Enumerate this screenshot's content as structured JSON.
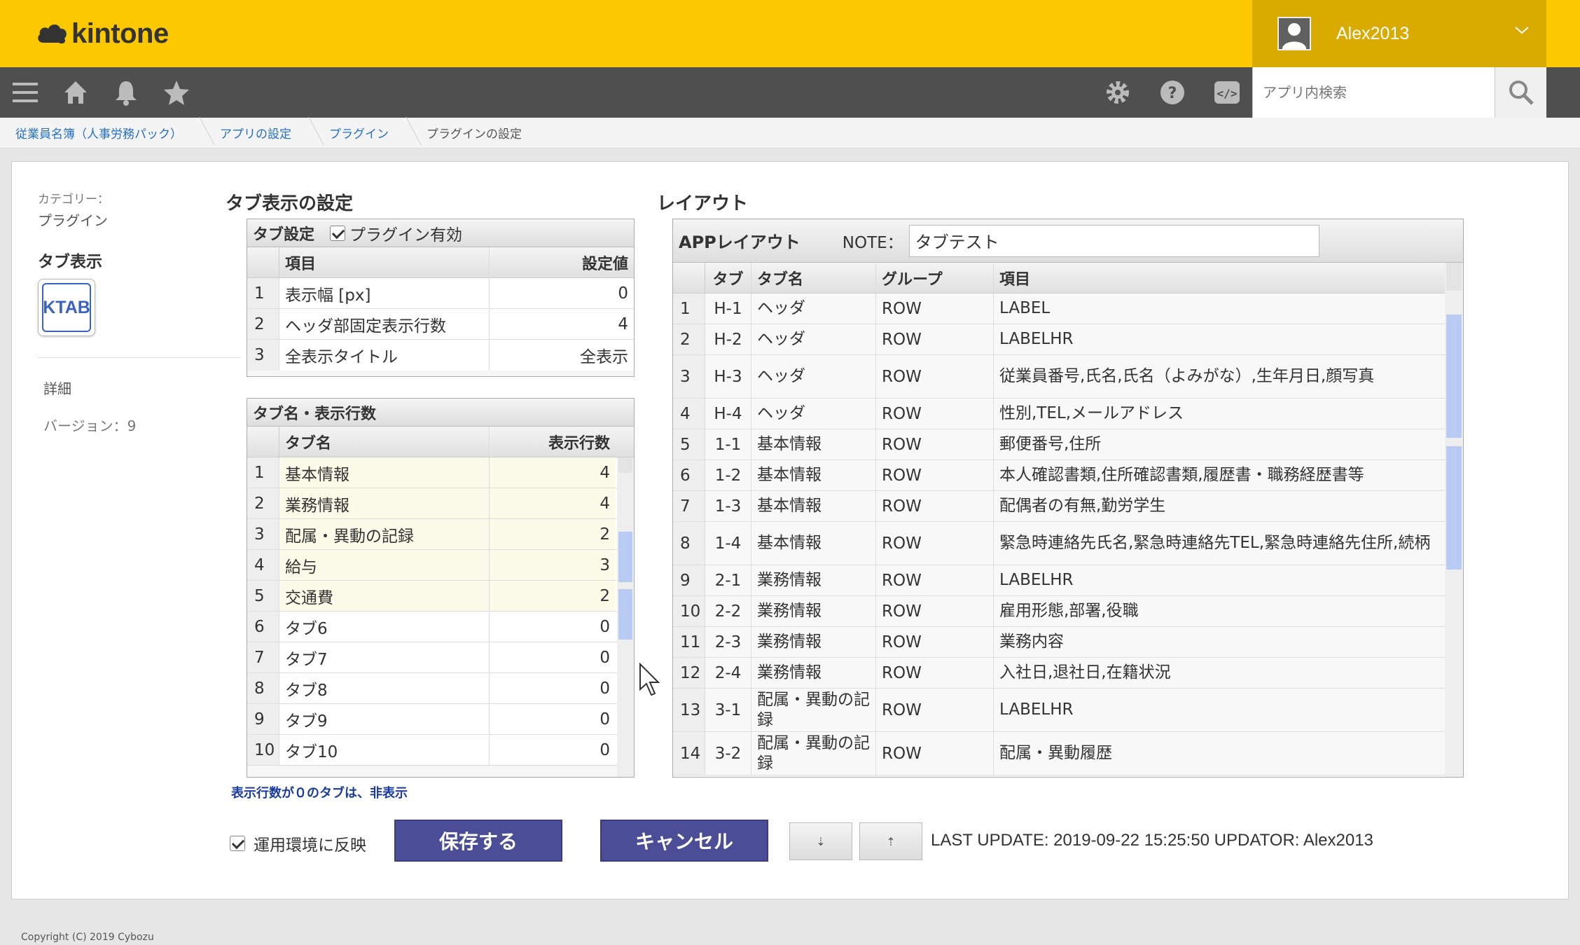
{
  "app": {
    "logo_text": "kintone",
    "user_name": "Alex2013"
  },
  "nav": {
    "search_placeholder": "アプリ内検索"
  },
  "breadcrumb": [
    "従業員名簿（人事労務パック）",
    "アプリの設定",
    "プラグイン",
    "プラグインの設定"
  ],
  "left": {
    "category_label": "カテゴリー：",
    "category_value": "プラグイン",
    "plugin_title": "タブ表示",
    "plugin_icon_text": "KTAB",
    "detail_link": "詳細",
    "version": "バージョン：9"
  },
  "tab_settings": {
    "section_title": "タブ表示の設定",
    "table_title": "タブ設定",
    "plugin_enabled_label": "プラグイン有効",
    "col_item": "項目",
    "col_value": "設定値",
    "rows": [
      {
        "n": "1",
        "item": "表示幅 [px]",
        "value": "0"
      },
      {
        "n": "2",
        "item": "ヘッダ部固定表示行数",
        "value": "4"
      },
      {
        "n": "3",
        "item": "全表示タイトル",
        "value": "全表示"
      }
    ]
  },
  "tab_names": {
    "table_title": "タブ名・表示行数",
    "col_name": "タブ名",
    "col_rows": "表示行数",
    "rows": [
      {
        "n": "1",
        "name": "基本情報",
        "rows": "4"
      },
      {
        "n": "2",
        "name": "業務情報",
        "rows": "4"
      },
      {
        "n": "3",
        "name": "配属・異動の記録",
        "rows": "2"
      },
      {
        "n": "4",
        "name": "給与",
        "rows": "3"
      },
      {
        "n": "5",
        "name": "交通費",
        "rows": "2"
      },
      {
        "n": "6",
        "name": "タブ6",
        "rows": "0"
      },
      {
        "n": "7",
        "name": "タブ7",
        "rows": "0"
      },
      {
        "n": "8",
        "name": "タブ8",
        "rows": "0"
      },
      {
        "n": "9",
        "name": "タブ9",
        "rows": "0"
      },
      {
        "n": "10",
        "name": "タブ10",
        "rows": "0"
      }
    ],
    "note": "表示行数が０のタブは、非表示"
  },
  "layout": {
    "section_title": "レイアウト",
    "table_title": "APPレイアウト",
    "note_label": "NOTE：",
    "note_value": "タブテスト",
    "cols": [
      "タブ",
      "タブ名",
      "グループ",
      "項目"
    ],
    "rows": [
      {
        "n": "1",
        "tab": "H-1",
        "name": "ヘッダ",
        "group": "ROW",
        "items": "LABEL"
      },
      {
        "n": "2",
        "tab": "H-2",
        "name": "ヘッダ",
        "group": "ROW",
        "items": "LABELHR"
      },
      {
        "n": "3",
        "tab": "H-3",
        "name": "ヘッダ",
        "group": "ROW",
        "items": "従業員番号,氏名,氏名（よみがな）,生年月日,顔写真"
      },
      {
        "n": "4",
        "tab": "H-4",
        "name": "ヘッダ",
        "group": "ROW",
        "items": "性別,TEL,メールアドレス"
      },
      {
        "n": "5",
        "tab": "1-1",
        "name": "基本情報",
        "group": "ROW",
        "items": "郵便番号,住所"
      },
      {
        "n": "6",
        "tab": "1-2",
        "name": "基本情報",
        "group": "ROW",
        "items": "本人確認書類,住所確認書類,履歴書・職務経歴書等"
      },
      {
        "n": "7",
        "tab": "1-3",
        "name": "基本情報",
        "group": "ROW",
        "items": "配偶者の有無,勤労学生"
      },
      {
        "n": "8",
        "tab": "1-4",
        "name": "基本情報",
        "group": "ROW",
        "items": "緊急時連絡先氏名,緊急時連絡先TEL,緊急時連絡先住所,続柄"
      },
      {
        "n": "9",
        "tab": "2-1",
        "name": "業務情報",
        "group": "ROW",
        "items": "LABELHR"
      },
      {
        "n": "10",
        "tab": "2-2",
        "name": "業務情報",
        "group": "ROW",
        "items": "雇用形態,部署,役職"
      },
      {
        "n": "11",
        "tab": "2-3",
        "name": "業務情報",
        "group": "ROW",
        "items": "業務内容"
      },
      {
        "n": "12",
        "tab": "2-4",
        "name": "業務情報",
        "group": "ROW",
        "items": "入社日,退社日,在籍状況"
      },
      {
        "n": "13",
        "tab": "3-1",
        "name": "配属・異動の記録",
        "group": "ROW",
        "items": "LABELHR"
      },
      {
        "n": "14",
        "tab": "3-2",
        "name": "配属・異動の記録",
        "group": "ROW",
        "items": "配属・異動履歴"
      }
    ]
  },
  "actions": {
    "deploy_label": "運用環境に反映",
    "save_label": "保存する",
    "cancel_label": "キャンセル",
    "download_icon_label": "⇣",
    "upload_icon_label": "⇡",
    "last_update": "LAST UPDATE: 2019-09-22 15:25:50 UPDATOR: Alex2013"
  },
  "footer": {
    "copyright": "Copyright (C) 2019 Cybozu"
  }
}
